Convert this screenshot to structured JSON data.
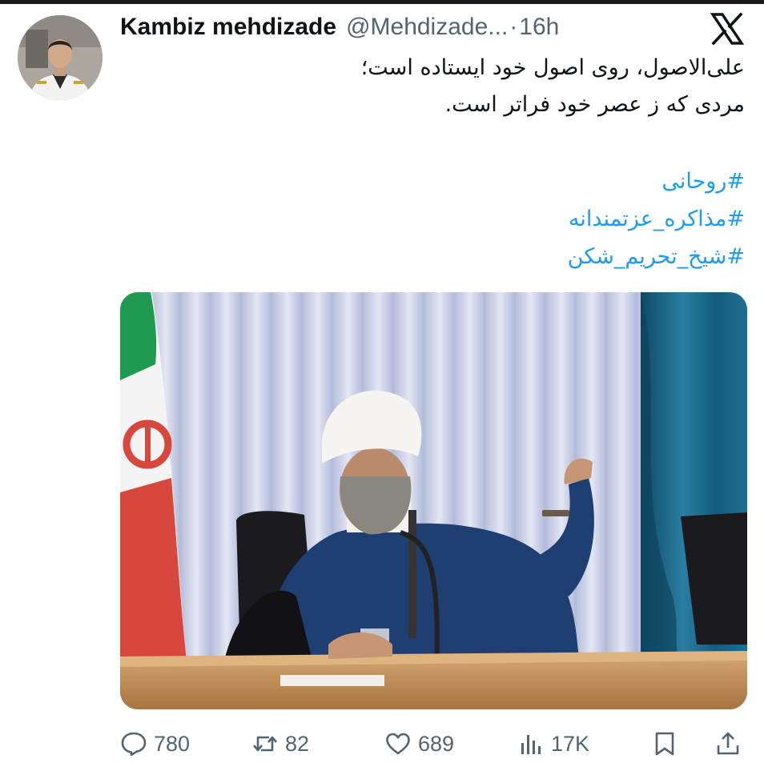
{
  "tweet": {
    "author_name": "Kambiz mehdizade",
    "author_handle": "@Mehdizade...",
    "separator": "·",
    "time": "16h",
    "text_lines": [
      "علی‌الاصول، روی اصول خود ایستاده است؛",
      "مردی که ز عصر خود فراتر است."
    ],
    "hashtags": [
      "#روحانی",
      "#مذاکره_عزتمندانه",
      "#شیخ_تحریم_شکن"
    ]
  },
  "icons": {
    "platform_logo": "x-logo-icon",
    "reply": "reply-icon",
    "repost": "repost-icon",
    "like": "heart-icon",
    "views": "views-chart-icon",
    "bookmark": "bookmark-icon",
    "share": "share-icon"
  },
  "stats": {
    "replies": "780",
    "reposts": "82",
    "likes": "689",
    "views": "17K"
  },
  "colors": {
    "text": "#0f1419",
    "secondary": "#536471",
    "link": "#1d9bf0"
  }
}
